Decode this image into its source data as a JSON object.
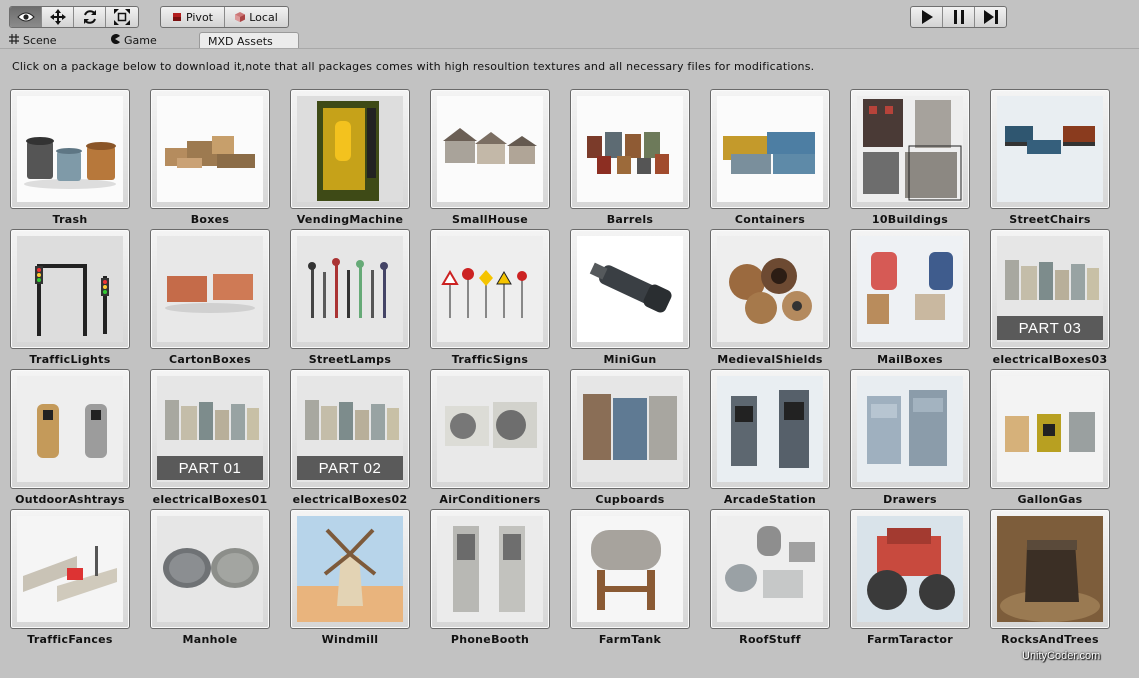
{
  "toolbar": {
    "transform_tools": [
      {
        "name": "view-icon",
        "active": true
      },
      {
        "name": "move-icon",
        "active": false
      },
      {
        "name": "rotate-icon",
        "active": false
      },
      {
        "name": "scale-icon",
        "active": false
      }
    ],
    "pivot_label": "Pivot",
    "local_label": "Local",
    "play_controls": [
      "play-icon",
      "pause-icon",
      "step-icon"
    ]
  },
  "tabs": [
    {
      "label": "Scene",
      "icon": "grid-icon"
    },
    {
      "label": "Game",
      "icon": "pacman-icon"
    },
    {
      "label": "MXD Assets",
      "icon": "",
      "active": true
    }
  ],
  "intro_text": "Click on a package below to download it,note that all packages comes with high resoultion textures and all necessary files for modifications.",
  "packages": [
    {
      "label": "Trash",
      "theme": "trash"
    },
    {
      "label": "Boxes",
      "theme": "boxes"
    },
    {
      "label": "VendingMachine",
      "theme": "vending"
    },
    {
      "label": "SmallHouse",
      "theme": "house"
    },
    {
      "label": "Barrels",
      "theme": "barrels"
    },
    {
      "label": "Containers",
      "theme": "containers"
    },
    {
      "label": "10Buildings",
      "theme": "buildings"
    },
    {
      "label": "StreetChairs",
      "theme": "chairs"
    },
    {
      "label": "TrafficLights",
      "theme": "trafficlights"
    },
    {
      "label": "CartonBoxes",
      "theme": "cartons"
    },
    {
      "label": "StreetLamps",
      "theme": "lamps"
    },
    {
      "label": "TrafficSigns",
      "theme": "signs"
    },
    {
      "label": "MiniGun",
      "theme": "minigun"
    },
    {
      "label": "MedievalShields",
      "theme": "shields"
    },
    {
      "label": "MailBoxes",
      "theme": "mailboxes"
    },
    {
      "label": "electricalBoxes03",
      "theme": "ebox",
      "part": "PART 03"
    },
    {
      "label": "OutdoorAshtrays",
      "theme": "ashtrays"
    },
    {
      "label": "electricalBoxes01",
      "theme": "ebox",
      "part": "PART 01"
    },
    {
      "label": "electricalBoxes02",
      "theme": "ebox",
      "part": "PART 02"
    },
    {
      "label": "AirConditioners",
      "theme": "ac"
    },
    {
      "label": "Cupboards",
      "theme": "cupboards"
    },
    {
      "label": "ArcadeStation",
      "theme": "arcade"
    },
    {
      "label": "Drawers",
      "theme": "drawers"
    },
    {
      "label": "GallonGas",
      "theme": "gallon"
    },
    {
      "label": "TrafficFances",
      "theme": "fences"
    },
    {
      "label": "Manhole",
      "theme": "manhole"
    },
    {
      "label": "Windmill",
      "theme": "windmill"
    },
    {
      "label": "PhoneBooth",
      "theme": "phonebooth"
    },
    {
      "label": "FarmTank",
      "theme": "farmtank"
    },
    {
      "label": "RoofStuff",
      "theme": "roofstuff"
    },
    {
      "label": "FarmTaractor",
      "theme": "tractor"
    },
    {
      "label": "RocksAndTrees",
      "theme": "rocks"
    }
  ],
  "watermark": "UnityCoder.com"
}
